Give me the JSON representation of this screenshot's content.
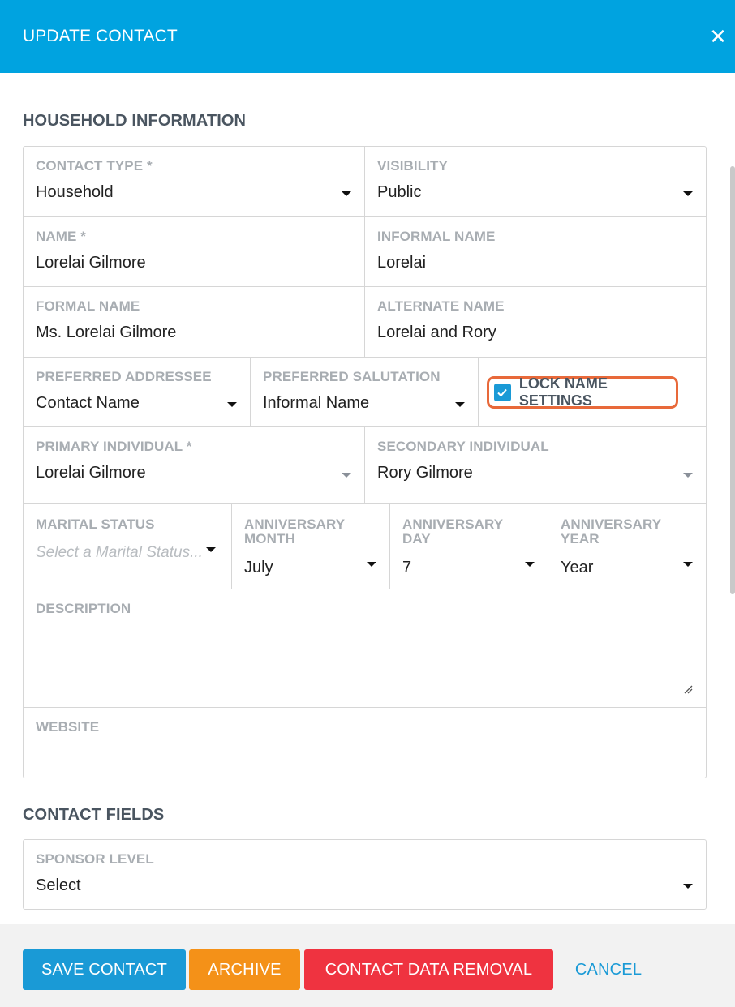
{
  "header": {
    "title": "UPDATE CONTACT",
    "close_icon": "close-icon"
  },
  "household": {
    "section_title": "HOUSEHOLD INFORMATION",
    "contact_type": {
      "label": "CONTACT TYPE *",
      "value": "Household"
    },
    "visibility": {
      "label": "VISIBILITY",
      "value": "Public"
    },
    "name": {
      "label": "NAME *",
      "value": "Lorelai Gilmore"
    },
    "informal_name": {
      "label": "INFORMAL NAME",
      "value": "Lorelai"
    },
    "formal_name": {
      "label": "FORMAL NAME",
      "value": "Ms. Lorelai Gilmore"
    },
    "alternate_name": {
      "label": "ALTERNATE NAME",
      "value": "Lorelai and Rory"
    },
    "preferred_addressee": {
      "label": "PREFERRED ADDRESSEE",
      "value": "Contact Name"
    },
    "preferred_salutation": {
      "label": "PREFERRED SALUTATION",
      "value": "Informal Name"
    },
    "lock_name_settings": {
      "label": "LOCK NAME SETTINGS",
      "checked": true
    },
    "primary_individual": {
      "label": "PRIMARY INDIVIDUAL *",
      "value": "Lorelai Gilmore"
    },
    "secondary_individual": {
      "label": "SECONDARY INDIVIDUAL",
      "value": "Rory Gilmore"
    },
    "marital_status": {
      "label": "MARITAL STATUS",
      "placeholder": "Select a Marital Status..."
    },
    "anniversary_month": {
      "label": "ANNIVERSARY MONTH",
      "value": "July"
    },
    "anniversary_day": {
      "label": "ANNIVERSARY DAY",
      "value": "7"
    },
    "anniversary_year": {
      "label": "ANNIVERSARY YEAR",
      "value": "Year"
    },
    "description": {
      "label": "DESCRIPTION",
      "value": ""
    },
    "website": {
      "label": "WEBSITE",
      "value": ""
    }
  },
  "contact_fields": {
    "section_title": "CONTACT FIELDS",
    "sponsor_level": {
      "label": "SPONSOR LEVEL",
      "value": "Select"
    }
  },
  "footer": {
    "save_label": "SAVE CONTACT",
    "archive_label": "ARCHIVE",
    "removal_label": "CONTACT DATA REMOVAL",
    "cancel_label": "CANCEL"
  },
  "colors": {
    "header": "#00a3e0",
    "save": "#1a9ad6",
    "archive": "#f49118",
    "removal": "#ef3340",
    "highlight": "#e8693a"
  }
}
